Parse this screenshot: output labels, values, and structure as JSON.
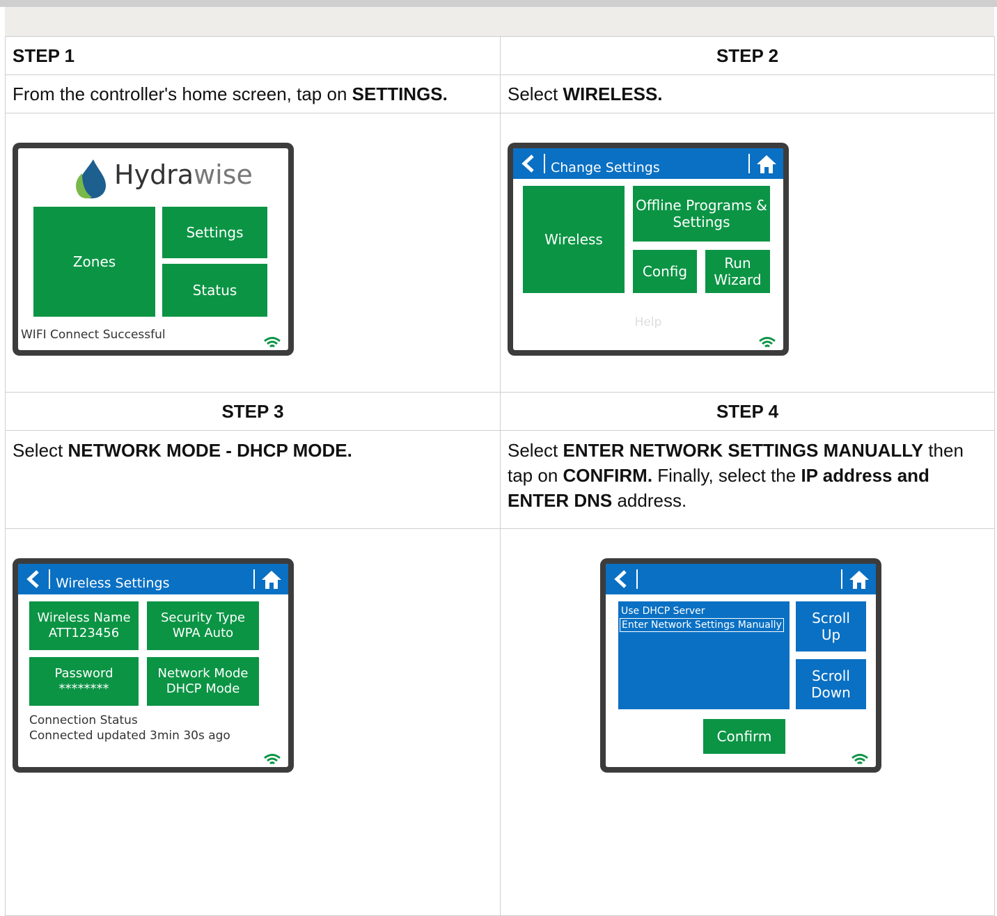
{
  "steps": {
    "s1": {
      "title": "STEP 1",
      "text_parts": [
        "From the controller's home screen, tap on ",
        "SETTINGS."
      ]
    },
    "s2": {
      "title": "STEP 2",
      "text_parts": [
        "Select ",
        "WIRELESS."
      ]
    },
    "s3": {
      "title": "STEP 3",
      "text_parts": [
        "Select ",
        "NETWORK MODE - DHCP MODE."
      ]
    },
    "s4": {
      "title": "STEP 4",
      "text_parts": [
        "Select ",
        "ENTER NETWORK SETTINGS MANUALLY",
        " then tap on ",
        "CONFIRM.",
        " Finally, select the ",
        "IP address and ENTER DNS",
        " address."
      ]
    }
  },
  "screen1": {
    "logo_bold": "Hydra",
    "logo_light": "wise",
    "zones": "Zones",
    "settings": "Settings",
    "status": "Status",
    "status_text": "WIFI Connect Successful"
  },
  "screen2": {
    "title": "Change Settings",
    "wireless": "Wireless",
    "offline_line1": "Offline Programs &",
    "offline_line2": "Settings",
    "config": "Config",
    "run_line1": "Run",
    "run_line2": "Wizard",
    "help": "Help"
  },
  "screen3": {
    "title": "Wireless Settings",
    "wireless_name_label": "Wireless Name",
    "wireless_name_value": "ATT123456",
    "security_label": "Security Type",
    "security_value": "WPA Auto",
    "password_label": "Password",
    "password_value": "********",
    "network_label": "Network Mode",
    "network_value": "DHCP Mode",
    "conn_label": "Connection Status",
    "conn_value": "Connected updated 3min 30s ago"
  },
  "screen4": {
    "option1": "Use DHCP Server",
    "option2": "Enter Network Settings Manually",
    "scroll_up_line1": "Scroll",
    "scroll_up_line2": "Up",
    "scroll_down_line1": "Scroll",
    "scroll_down_line2": "Down",
    "confirm": "Confirm"
  },
  "colors": {
    "green": "#0b9444",
    "blue": "#0a70c3",
    "frame": "#3c3c3c"
  }
}
